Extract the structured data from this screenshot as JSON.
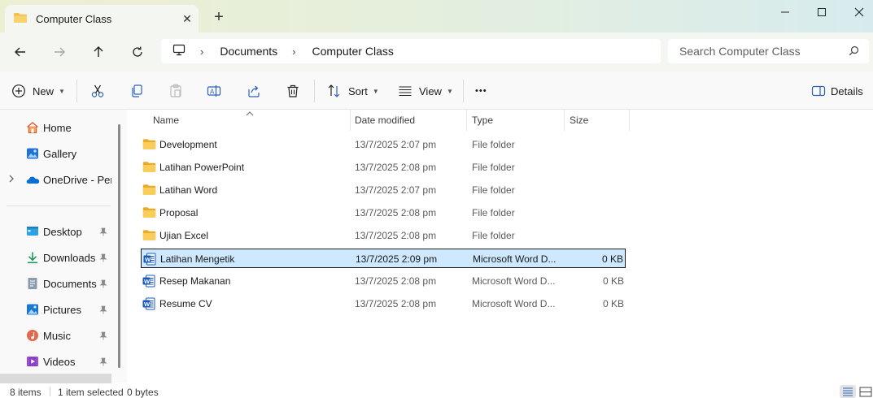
{
  "window": {
    "tab_title": "Computer Class",
    "new_tab": "+",
    "close_tab": "✕"
  },
  "address": {
    "crumbs": [
      "Documents",
      "Computer Class"
    ],
    "separator": "›",
    "search_placeholder": "Search Computer Class"
  },
  "toolbar": {
    "new_label": "New",
    "sort_label": "Sort",
    "view_label": "View",
    "more_label": "•••",
    "details_label": "Details"
  },
  "sidebar": {
    "items": [
      {
        "label": "Home",
        "icon": "home-icon"
      },
      {
        "label": "Gallery",
        "icon": "gallery-icon"
      },
      {
        "label": "OneDrive - Personal",
        "icon": "onedrive-icon"
      },
      {
        "label": "Desktop",
        "icon": "desktop-icon"
      },
      {
        "label": "Downloads",
        "icon": "downloads-icon"
      },
      {
        "label": "Documents",
        "icon": "documents-icon"
      },
      {
        "label": "Pictures",
        "icon": "pictures-icon"
      },
      {
        "label": "Music",
        "icon": "music-icon"
      },
      {
        "label": "Videos",
        "icon": "videos-icon"
      }
    ]
  },
  "columns": {
    "name": "Name",
    "date": "Date modified",
    "type": "Type",
    "size": "Size"
  },
  "files": [
    {
      "name": "Development",
      "date": "13/7/2025 2:07 pm",
      "type": "File folder",
      "size": "",
      "kind": "folder"
    },
    {
      "name": "Latihan PowerPoint",
      "date": "13/7/2025 2:08 pm",
      "type": "File folder",
      "size": "",
      "kind": "folder"
    },
    {
      "name": "Latihan Word",
      "date": "13/7/2025 2:07 pm",
      "type": "File folder",
      "size": "",
      "kind": "folder"
    },
    {
      "name": "Proposal",
      "date": "13/7/2025 2:08 pm",
      "type": "File folder",
      "size": "",
      "kind": "folder"
    },
    {
      "name": "Ujian Excel",
      "date": "13/7/2025 2:08 pm",
      "type": "File folder",
      "size": "",
      "kind": "folder"
    },
    {
      "name": "Latihan Mengetik",
      "date": "13/7/2025 2:09 pm",
      "type": "Microsoft Word D...",
      "size": "0 KB",
      "kind": "word",
      "selected": true
    },
    {
      "name": "Resep Makanan",
      "date": "13/7/2025 2:08 pm",
      "type": "Microsoft Word D...",
      "size": "0 KB",
      "kind": "word"
    },
    {
      "name": "Resume CV",
      "date": "13/7/2025 2:08 pm",
      "type": "Microsoft Word D...",
      "size": "0 KB",
      "kind": "word"
    }
  ],
  "status": {
    "item_count": "8 items",
    "selection": "1 item selected",
    "selection_size": "0 bytes"
  },
  "colors": {
    "selection_bg": "#cde8ff",
    "folder": "#f4c04d",
    "word_blue": "#185abd",
    "accent": "#0067c0"
  }
}
